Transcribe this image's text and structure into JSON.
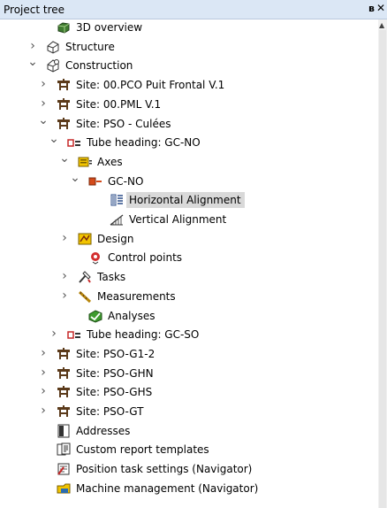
{
  "panel": {
    "title": "Project tree",
    "pin_glyph": "ʙ",
    "close_glyph": "✕"
  },
  "tree": [
    {
      "id": "3d-overview",
      "label": "3D overview",
      "icon": "3d-overview-icon",
      "chevron": null,
      "indent": 2
    },
    {
      "id": "structure",
      "label": "Structure",
      "icon": "structure-icon",
      "chevron": "right",
      "indent": 1
    },
    {
      "id": "construction",
      "label": "Construction",
      "icon": "construction-icon",
      "chevron": "down",
      "indent": 1
    },
    {
      "id": "site-pco",
      "label": "Site: 00.PCO Puit Frontal V.1",
      "icon": "site-icon",
      "chevron": "right",
      "indent": 2
    },
    {
      "id": "site-pml",
      "label": "Site: 00.PML V.1",
      "icon": "site-icon",
      "chevron": "right",
      "indent": 2
    },
    {
      "id": "site-pso-culees",
      "label": "Site: PSO - Culées",
      "icon": "site-icon",
      "chevron": "down",
      "indent": 2
    },
    {
      "id": "tube-heading-gc-no",
      "label": "Tube heading: GC-NO",
      "icon": "tube-heading-icon",
      "chevron": "down",
      "indent": 3
    },
    {
      "id": "axes",
      "label": "Axes",
      "icon": "axes-icon",
      "chevron": "down",
      "indent": 4
    },
    {
      "id": "gc-no",
      "label": "GC-NO",
      "icon": "alignment-axis-icon",
      "chevron": "down",
      "indent": 5
    },
    {
      "id": "horizontal-alignment",
      "label": "Horizontal Alignment",
      "icon": "horizontal-alignment-icon",
      "chevron": null,
      "indent": 7,
      "selected": true
    },
    {
      "id": "vertical-alignment",
      "label": "Vertical Alignment",
      "icon": "vertical-alignment-icon",
      "chevron": null,
      "indent": 7
    },
    {
      "id": "design",
      "label": "Design",
      "icon": "design-icon",
      "chevron": "right",
      "indent": 4
    },
    {
      "id": "control-points",
      "label": "Control points",
      "icon": "control-points-icon",
      "chevron": null,
      "indent": 5
    },
    {
      "id": "tasks",
      "label": "Tasks",
      "icon": "tasks-icon",
      "chevron": "right",
      "indent": 4
    },
    {
      "id": "measurements",
      "label": "Measurements",
      "icon": "measurements-icon",
      "chevron": "right",
      "indent": 4
    },
    {
      "id": "analyses",
      "label": "Analyses",
      "icon": "analyses-icon",
      "chevron": null,
      "indent": 5
    },
    {
      "id": "tube-heading-gc-so",
      "label": "Tube heading: GC-SO",
      "icon": "tube-heading-icon",
      "chevron": "right",
      "indent": 3
    },
    {
      "id": "site-pso-g1-2",
      "label": "Site: PSO-G1-2",
      "icon": "site-icon",
      "chevron": "right",
      "indent": 2
    },
    {
      "id": "site-pso-ghn",
      "label": "Site: PSO-GHN",
      "icon": "site-icon",
      "chevron": "right",
      "indent": 2
    },
    {
      "id": "site-pso-ghs",
      "label": "Site: PSO-GHS",
      "icon": "site-icon",
      "chevron": "right",
      "indent": 2
    },
    {
      "id": "site-pso-gt",
      "label": "Site: PSO-GT",
      "icon": "site-icon",
      "chevron": "right",
      "indent": 2
    },
    {
      "id": "addresses",
      "label": "Addresses",
      "icon": "addresses-icon",
      "chevron": null,
      "indent": 2
    },
    {
      "id": "custom-report-templates",
      "label": "Custom report templates",
      "icon": "report-template-icon",
      "chevron": null,
      "indent": 2
    },
    {
      "id": "position-task-settings",
      "label": "Position task settings (Navigator)",
      "icon": "position-task-icon",
      "chevron": null,
      "indent": 2
    },
    {
      "id": "machine-management",
      "label": "Machine management (Navigator)",
      "icon": "machine-management-icon",
      "chevron": null,
      "indent": 2
    }
  ]
}
